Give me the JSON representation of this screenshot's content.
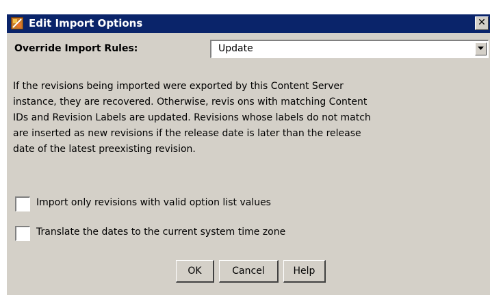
{
  "window": {
    "title": "Edit Import Options",
    "close_label": "✕"
  },
  "override": {
    "label": "Override Import Rules:",
    "selected": "Update"
  },
  "description": {
    "lines": [
      "If the revisions being imported were exported by this Content Server",
      "instance, they are recovered. Otherwise, revis ons with matching Content",
      "IDs and Revision Labels are updated. Revisions whose labels do not match",
      "are inserted as new revisions if the release date is later than the release",
      "date of the latest preexisting revision."
    ]
  },
  "options": {
    "valid_option_values": {
      "label": "Import only revisions with valid option list values",
      "checked": false
    },
    "translate_dates": {
      "label": "Translate the dates to the current system time zone",
      "checked": false
    }
  },
  "buttons": {
    "ok": "OK",
    "cancel": "Cancel",
    "help": "Help"
  },
  "colors": {
    "titlebar": "#0a246a",
    "dialog_face": "#d4d0c8",
    "field_background": "#ffffff"
  }
}
